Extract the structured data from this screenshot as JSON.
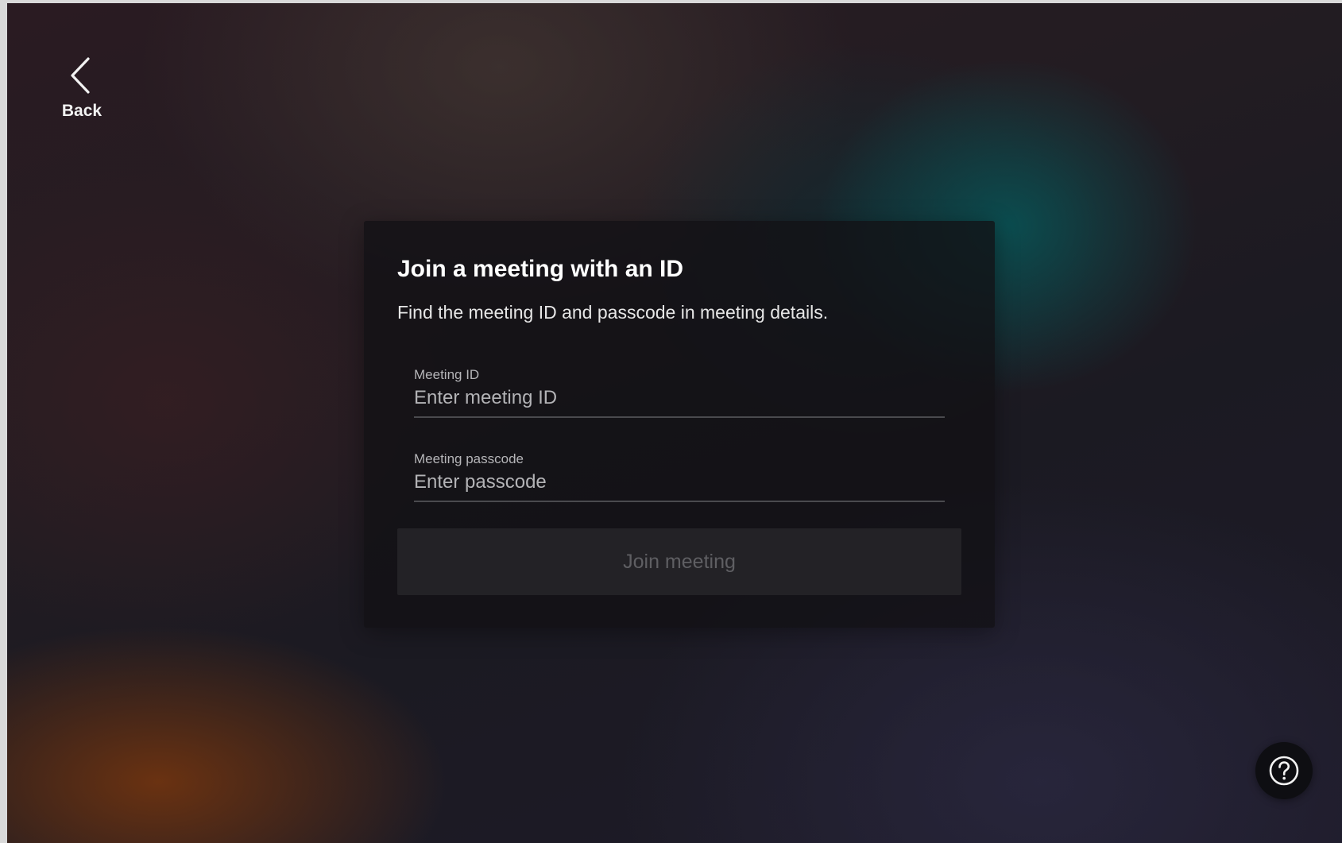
{
  "nav": {
    "back_label": "Back",
    "back_icon": "chevron-left-icon"
  },
  "card": {
    "title": "Join a meeting with an ID",
    "subtitle": "Find the meeting ID and passcode in meeting details.",
    "meeting_id": {
      "label": "Meeting ID",
      "value": "",
      "placeholder": "Enter meeting ID"
    },
    "passcode": {
      "label": "Meeting passcode",
      "value": "",
      "placeholder": "Enter passcode"
    },
    "join_label": "Join meeting"
  },
  "help": {
    "icon": "question-mark-icon"
  },
  "colors": {
    "card_background": "#121114",
    "button_disabled_text": "#5f5f63",
    "teal_glow": "#085456",
    "orange_glow": "#78360e"
  }
}
